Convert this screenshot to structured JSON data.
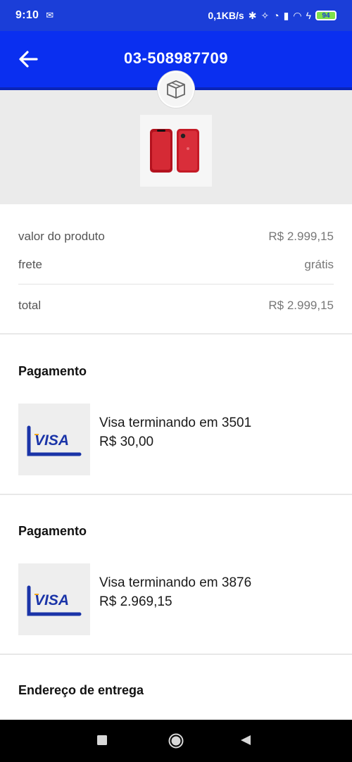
{
  "status_bar": {
    "time": "9:10",
    "network_speed": "0,1KB/s",
    "battery_level": "94"
  },
  "app_bar": {
    "title": "03-508987709",
    "back_icon": "arrow-left-icon"
  },
  "product": {
    "badge_icon": "package-icon",
    "thumbnail": "red-phone-image"
  },
  "summary": {
    "product_value_label": "valor do produto",
    "product_value": "R$ 2.999,15",
    "shipping_label": "frete",
    "shipping_value": "grátis",
    "total_label": "total",
    "total_value": "R$ 2.999,15"
  },
  "payments": [
    {
      "title": "Pagamento",
      "card_brand": "VISA",
      "description": "Visa terminando em 3501",
      "amount": "R$ 30,00"
    },
    {
      "title": "Pagamento",
      "card_brand": "VISA",
      "description": "Visa terminando em 3876",
      "amount": "R$ 2.969,15"
    }
  ],
  "address": {
    "title": "Endereço de entrega"
  },
  "colors": {
    "status_bar": "#1b3ed8",
    "app_bar": "#0a2ff0",
    "visa_blue": "#1a34a8",
    "visa_gold": "#f4a81d"
  }
}
